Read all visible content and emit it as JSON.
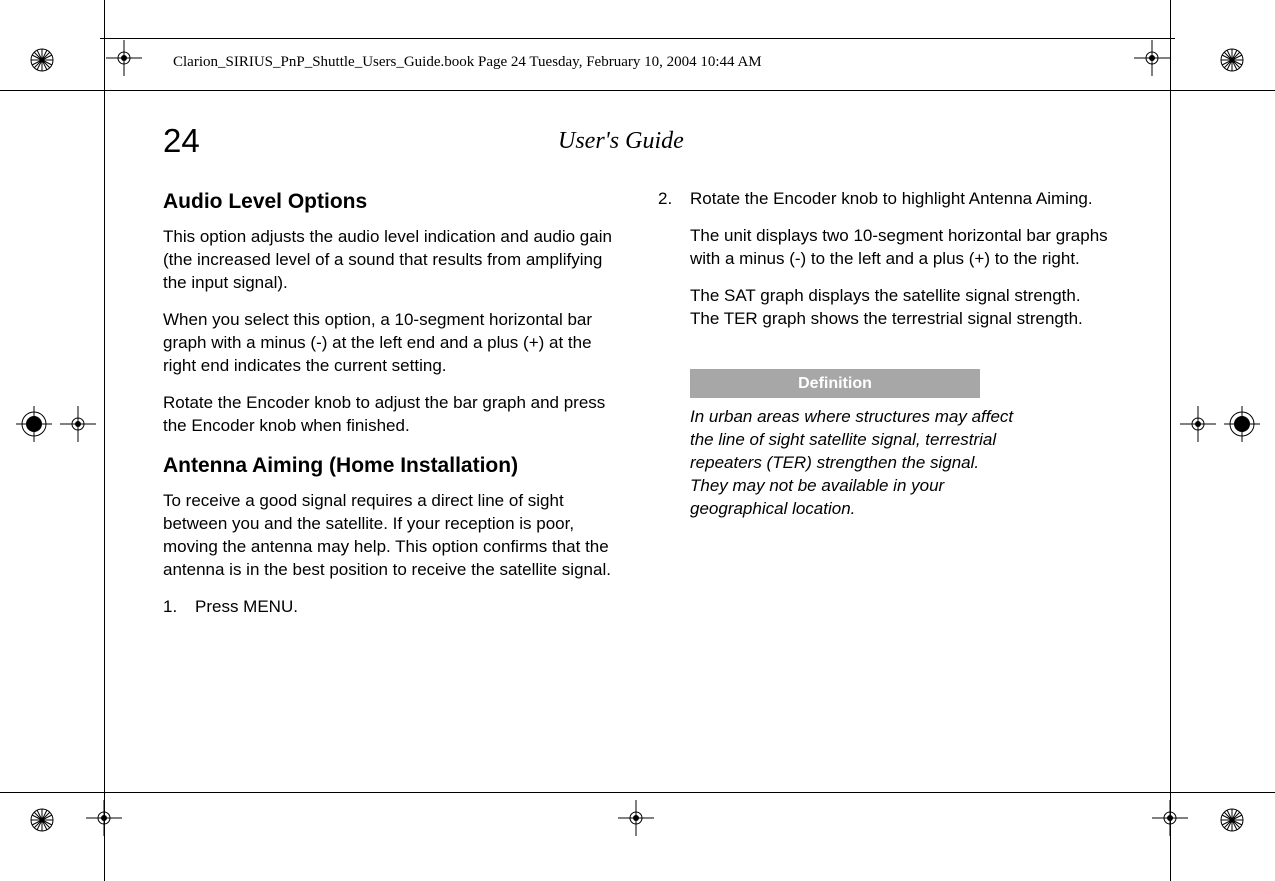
{
  "header_line": "Clarion_SIRIUS_PnP_Shuttle_Users_Guide.book  Page 24  Tuesday, February 10, 2004  10:44 AM",
  "page_number": "24",
  "doc_title": "User's Guide",
  "col1": {
    "h1": "Audio Level Options",
    "p1": "This option adjusts the audio level indication and audio gain (the increased level of a sound that results from amplifying the input signal).",
    "p2": "When you select this option, a 10-segment horizontal bar graph with a minus (-) at the left end and a plus (+) at the right end indicates the current setting.",
    "p3": "Rotate the Encoder knob to adjust the bar graph and press the Encoder knob when finished.",
    "h2": "Antenna Aiming (Home Installation)",
    "p4": "To receive a good signal requires a direct line of sight between you and the satellite. If your reception is poor, moving the antenna may help. This option confirms that the antenna is in the best position to receive the satellite signal.",
    "step1_num": "1.",
    "step1_txt": "Press MENU."
  },
  "col2": {
    "step2_num": "2.",
    "step2_txt": "Rotate the Encoder knob to highlight Antenna Aiming.",
    "p1": "The unit displays two 10-segment horizontal bar graphs with a minus (-) to the left and a plus (+) to the right.",
    "p2": "The SAT graph displays the satellite signal strength. The TER graph shows the terrestrial signal strength.",
    "def_header": "Definition",
    "def_body": "In urban areas where structures may affect the line of sight satellite signal, terrestrial repeaters (TER) strengthen the signal. They may not be available in your geographical location."
  }
}
